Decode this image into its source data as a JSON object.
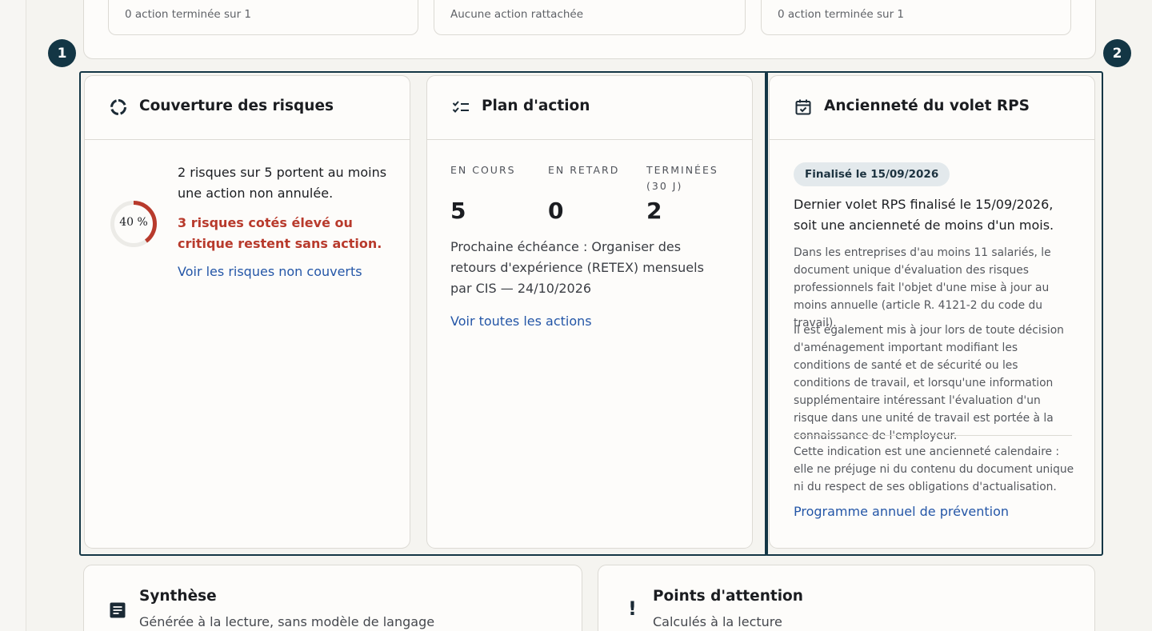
{
  "top_cards": [
    {
      "text": "0 action terminée sur 1"
    },
    {
      "text": "Aucune action rattachée"
    },
    {
      "text": "0 action terminée sur 1"
    }
  ],
  "badges": [
    "1",
    "2"
  ],
  "coverage": {
    "title": "Couverture des risques",
    "icon": "donut-chart-icon",
    "percent_label": "40 %",
    "percent": 40,
    "summary": "2 risques sur 5 portent au moins une action non annulée.",
    "warning": "3 risques cotés élevé ou critique restent sans action.",
    "link": "Voir les risques non couverts",
    "accent": "#b83a2c"
  },
  "action_plan": {
    "title": "Plan d'action",
    "icon": "checklist-icon",
    "stats": [
      {
        "label": "EN COURS",
        "value": "5"
      },
      {
        "label": "EN RETARD",
        "value": "0"
      },
      {
        "label": "TERMINÉES (30 J)",
        "value": "2"
      }
    ],
    "next_deadline": "Prochaine échéance : Organiser des retours d'expérience (RETEX) mensuels par CIS — 24/10/2026",
    "link": "Voir toutes les actions"
  },
  "rps": {
    "title": "Ancienneté du volet RPS",
    "icon": "calendar-check-icon",
    "badge": "Finalisé le 15/09/2026",
    "headline": "Dernier volet RPS finalisé le 15/09/2026, soit une ancienneté de moins d'un mois.",
    "para1": "Dans les entreprises d'au moins 11 salariés, le document unique d'évaluation des risques professionnels fait l'objet d'une mise à jour au moins annuelle (article R. 4121-2 du code du travail).",
    "para2": "Il est également mis à jour lors de toute décision d'aménagement important modifiant les conditions de santé et de sécurité ou les conditions de travail, et lorsqu'une information supplémentaire intéressant l'évaluation d'un risque dans une unité de travail est portée à la connaissance de l'employeur.",
    "note": "Cette indication est une ancienneté calendaire : elle ne préjuge ni du contenu du document unique ni du respect de ses obligations d'actualisation.",
    "link": "Programme annuel de prévention"
  },
  "synthesis": {
    "title": "Synthèse",
    "icon": "document-icon",
    "subtitle": "Générée à la lecture, sans modèle de langage"
  },
  "attention": {
    "title": "Points d'attention",
    "icon": "exclamation-icon",
    "subtitle": "Calculés à la lecture"
  },
  "colors": {
    "navy": "#133645",
    "link": "#2456a7",
    "danger": "#b83a2c"
  }
}
